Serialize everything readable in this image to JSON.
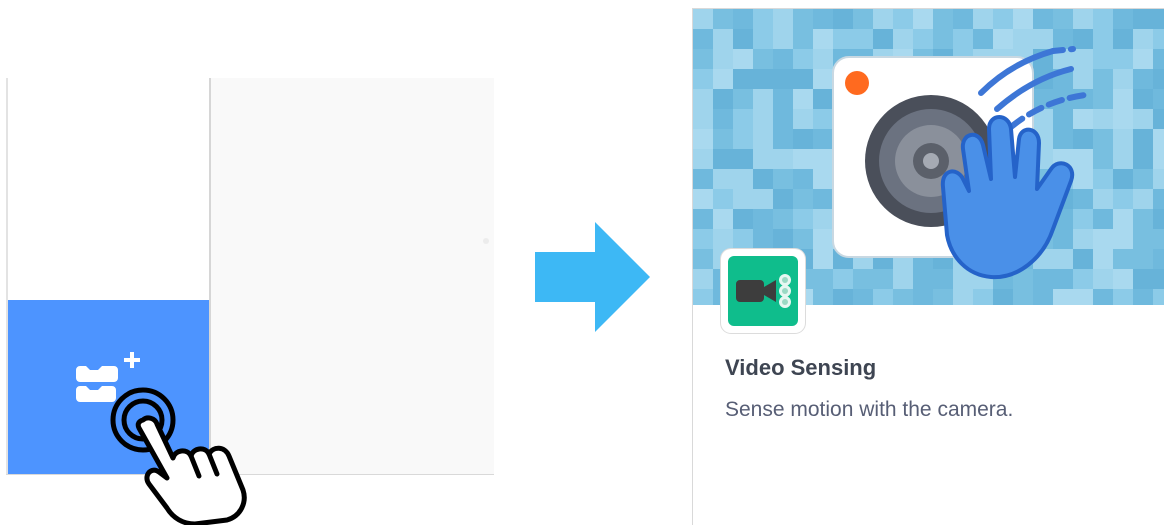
{
  "left_panel": {
    "extension_button": {
      "icon": "add-extension-icon",
      "color": "#4d94ff"
    },
    "cursor_icon": "tap-hand-icon"
  },
  "arrow": {
    "icon": "right-arrow-icon",
    "color": "#3db8f5"
  },
  "extension_card": {
    "title": "Video Sensing",
    "description": "Sense motion with the camera.",
    "banner_icon": "camera-wave-hand-icon",
    "small_icon": "video-camera-icon",
    "icon_color": "#0fbd8c",
    "banner_color": "#7fc3e3"
  }
}
